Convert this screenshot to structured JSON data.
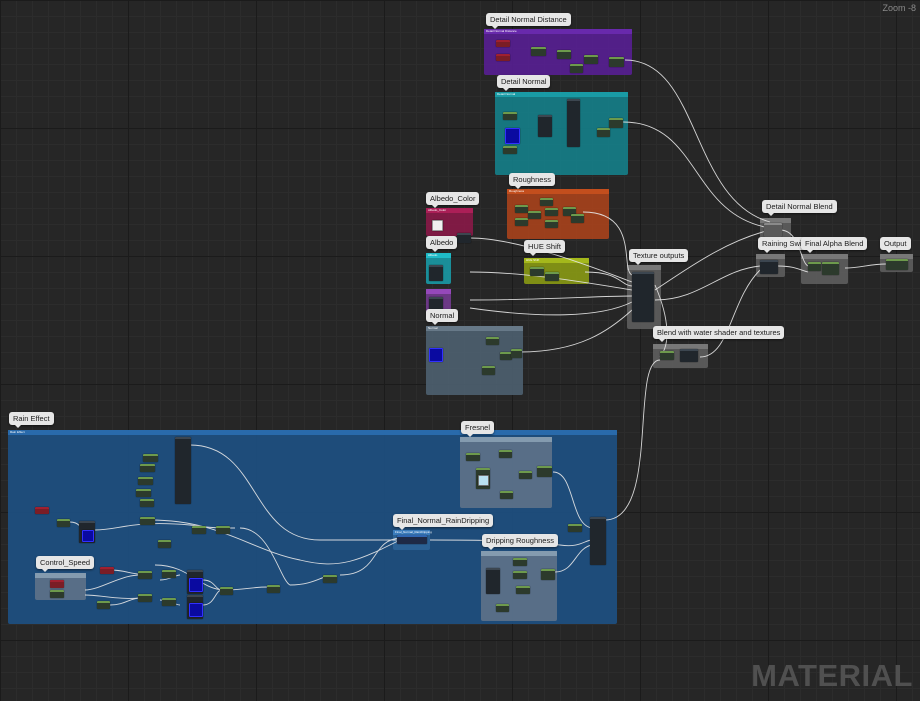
{
  "view": {
    "zoom_label": "Zoom -8",
    "watermark": "MATERIAL"
  },
  "comments": {
    "detail_normal_distance": {
      "title": "Detail Normal Distance",
      "subtitle": "Detail Normal Distance",
      "color": "#5a1e9a"
    },
    "detail_normal": {
      "title": "Detail Normal",
      "subtitle": "Detail Normal",
      "color": "#15808a"
    },
    "roughness": {
      "title": "Roughness",
      "subtitle": "Roughness",
      "color": "#a8421c"
    },
    "albedo_color": {
      "title": "Albedo_Color",
      "subtitle": "Albedo_Color",
      "color": "#8a1a48"
    },
    "albedo": {
      "title": "Albedo",
      "subtitle": "Albedo",
      "color": "#1a9aa6"
    },
    "hue_shift": {
      "title": "HUE Shift",
      "subtitle": "HUE Shift",
      "color": "#8a9a14"
    },
    "normal": {
      "title": "Normal",
      "subtitle": "Normal",
      "color": "#4e6070"
    },
    "texture_outputs": {
      "title": "Texture outputs",
      "color": "#5e5e5e"
    },
    "detail_normal_blend": {
      "title": "Detail Normal Blend",
      "color": "#5e5e5e"
    },
    "raining_switch": {
      "title": "Raining Switch",
      "color": "#5e5e5e"
    },
    "final_alpha_blend": {
      "title": "Final Alpha Blend",
      "color": "#5e5e5e"
    },
    "output": {
      "title": "Output",
      "color": "#5e5e5e"
    },
    "blend_water": {
      "title": "Blend with water shader and textures",
      "color": "#5e5e5e"
    },
    "rain_effect": {
      "title": "Rain Effect",
      "subtitle": "Rain Effect",
      "color": "#1d4e7e"
    },
    "fresnel": {
      "title": "Fresnel",
      "color": "#5e7288"
    },
    "final_normal_raindripping": {
      "title": "Final_Normal_RainDripping",
      "subtitle": "Final_Normal_RainDripping",
      "color": "#2c6296"
    },
    "dripping_roughness": {
      "title": "Dripping Roughness",
      "color": "#5e7288"
    },
    "control_speed": {
      "title": "Control_Speed",
      "color": "#5e7288"
    }
  }
}
